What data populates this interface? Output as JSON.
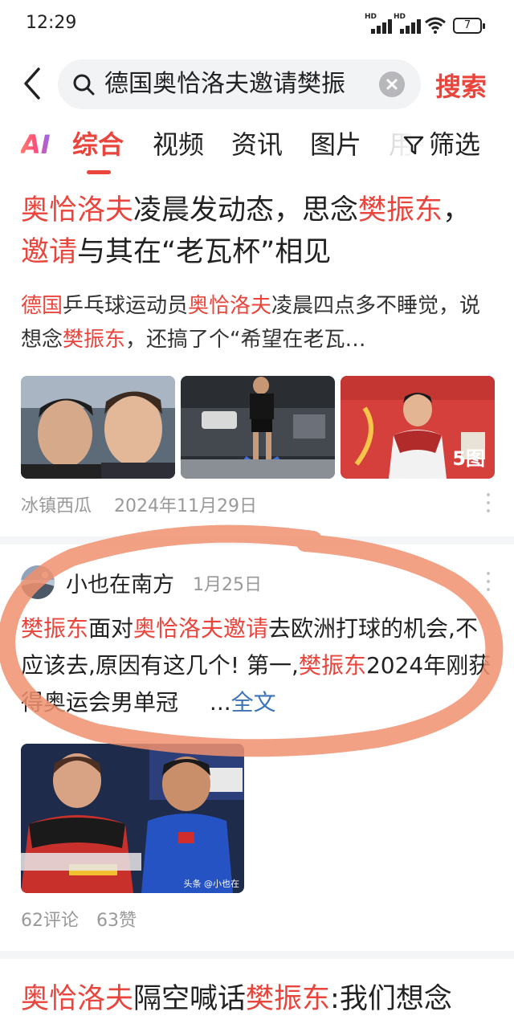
{
  "status_bar": {
    "time": "12:29",
    "signal_1": "HD",
    "signal_2": "HD",
    "battery": "7"
  },
  "search": {
    "query": "德国奥恰洛夫邀请樊振",
    "button_label": "搜索"
  },
  "tabs": [
    {
      "label": "AI"
    },
    {
      "label": "综合",
      "active": true
    },
    {
      "label": "视频"
    },
    {
      "label": "资讯"
    },
    {
      "label": "图片"
    },
    {
      "label": "用"
    }
  ],
  "filter_label": "筛选",
  "card1": {
    "title_parts": [
      "奥恰洛夫",
      "凌晨发动态，思念",
      "樊振东",
      "，",
      "邀请",
      "与其在“老瓦杯”相见"
    ],
    "desc_parts": [
      "德国",
      "乒乓球运动员",
      "奥恰洛夫",
      "凌晨四点多不睡觉，说想念",
      "樊振东",
      "，还搞了个“希望在老瓦…"
    ],
    "image_count": "5图",
    "source": "冰镇西瓜",
    "date": "2024年11月29日"
  },
  "card2": {
    "author": "小也在南方",
    "date": "1月25日",
    "text_parts": [
      "樊振东",
      "面对",
      "奥恰洛夫邀请",
      "去欧洲打球的机会,不应该去,原因有这几个! 第一,",
      "樊振东",
      "2024年刚获得奥运会男单冠"
    ],
    "ellipsis": "...",
    "full_text": "全文",
    "image_credit": "头条 @小也在",
    "comments": "62评论",
    "likes": "63赞"
  },
  "card3": {
    "title_parts": [
      "奥恰洛夫",
      "隔空喊话",
      "樊振东",
      ":我们想念"
    ]
  },
  "colors": {
    "accent": "#e9453c",
    "link": "#3c73b9",
    "annotation": "#f0906e"
  }
}
